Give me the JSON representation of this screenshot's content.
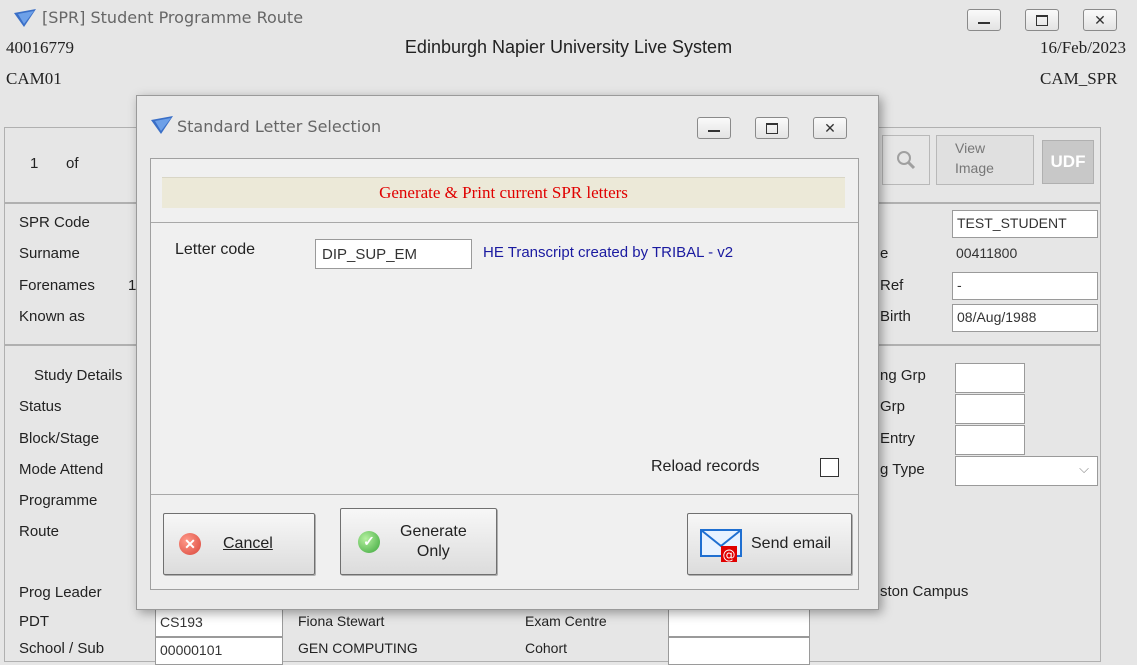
{
  "window": {
    "title": "[SPR] Student Programme Route",
    "user_id": "40016779",
    "system_name": "Edinburgh Napier University Live System",
    "date": "16/Feb/2023",
    "module_left": "CAM01",
    "module_right": "CAM_SPR"
  },
  "record_nav": {
    "current": "1",
    "of_label": "of"
  },
  "toolbar": {
    "view_image_line1": "View",
    "view_image_line2": "Image",
    "udf_label": "UDF"
  },
  "left_labels": [
    "SPR Code",
    "Surname",
    "Forenames",
    "Known as"
  ],
  "forenames_partial": "1",
  "right_labels": [
    "e",
    "Ref",
    "Birth"
  ],
  "right_values": [
    "TEST_STUDENT",
    "00411800",
    "-",
    "08/Aug/1988"
  ],
  "study": {
    "header": "Study Details",
    "labels": [
      "Status",
      "Block/Stage",
      "Mode Attend",
      "Programme",
      "Route"
    ],
    "right_labels": [
      "ng Grp",
      "Grp",
      "Entry",
      "g Type"
    ]
  },
  "bottom": {
    "labels": [
      "Prog Leader",
      "PDT",
      "School / Sub"
    ],
    "pdt_value": "CS193",
    "school_value": "00000101",
    "pdt_name": "Fiona Stewart",
    "school_name": "GEN COMPUTING",
    "exam_centre_label": "Exam Centre",
    "cohort_label": "Cohort",
    "campus": "ston Campus"
  },
  "dialog": {
    "title": "Standard Letter Selection",
    "banner": "Generate & Print current SPR letters",
    "letter_code_label": "Letter code",
    "letter_code_value": "DIP_SUP_EM",
    "letter_description": "HE Transcript created by TRIBAL - v2",
    "reload_label": "Reload records",
    "reload_checked": false,
    "cancel_label": "Cancel",
    "generate_line1": "Generate",
    "generate_line2": "Only",
    "send_email_label": "Send email"
  },
  "colors": {
    "banner_text": "#e00000",
    "description_text": "#1a1aa0",
    "accent_icon": "#1f6fd1"
  }
}
